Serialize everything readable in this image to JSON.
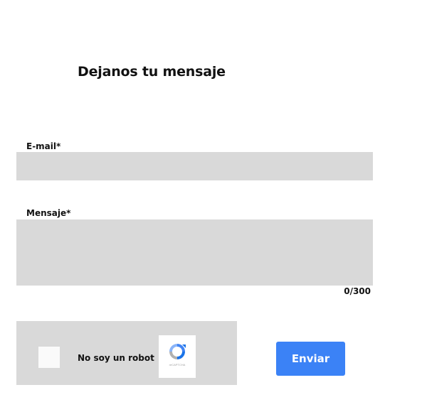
{
  "form": {
    "title": "Dejanos tu mensaje",
    "email": {
      "label": "E-mail*",
      "value": "",
      "placeholder": ""
    },
    "message": {
      "label": "Mensaje*",
      "value": "",
      "placeholder": "",
      "counter": "0/300"
    },
    "captcha": {
      "label": "No soy un robot",
      "checked": false,
      "logo_icon": "recaptcha-icon",
      "logo_text": "reCAPTCHA"
    },
    "submit_label": "Enviar"
  },
  "colors": {
    "field_background": "#d9d9d9",
    "button_background": "#3b82f6",
    "button_text": "#ffffff",
    "text": "#111111"
  }
}
